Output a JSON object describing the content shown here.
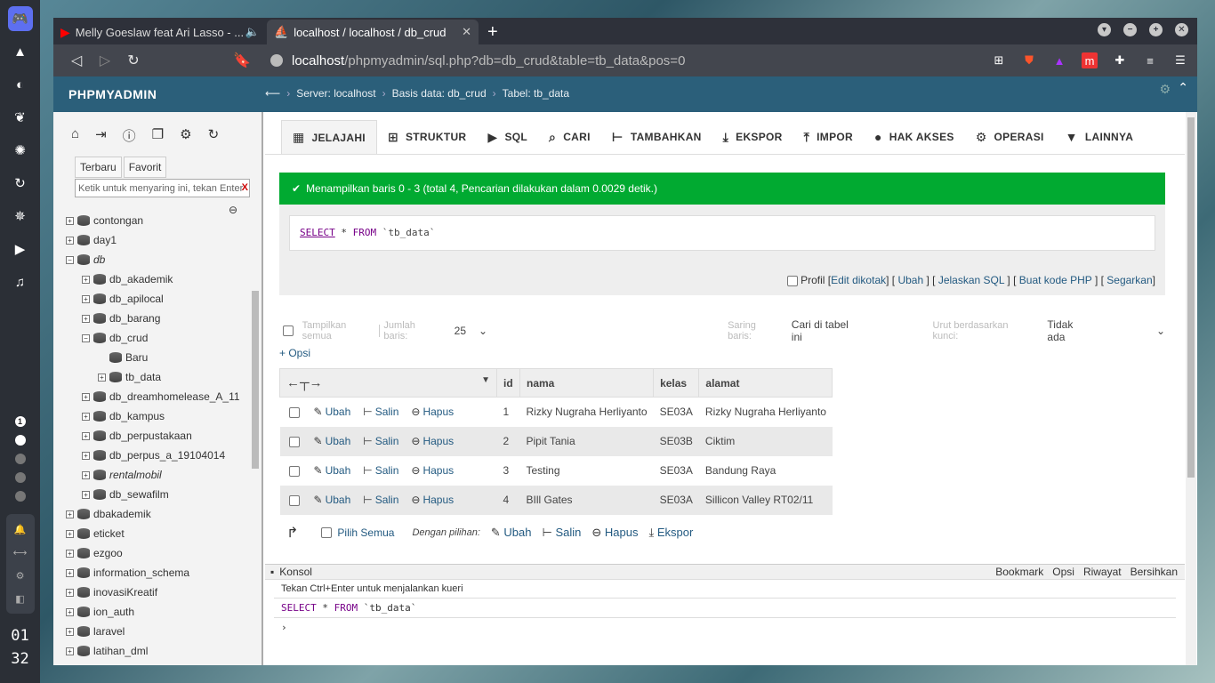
{
  "taskbar": {
    "clock_hour": "01",
    "clock_min": "32",
    "ws_num": "1"
  },
  "browser": {
    "tab1_title": "Melly Goeslaw feat Ari Lasso - ...",
    "tab2_title": "localhost / localhost / db_crud",
    "url_host": "localhost",
    "url_path": "/phpmyadmin/sql.php?db=db_crud&table=tb_data&pos=0"
  },
  "pma": {
    "logo": "PHPMYADMIN",
    "crumbs": [
      "Server: localhost",
      "Basis data: db_crud",
      "Tabel: tb_data"
    ],
    "side_tabs": [
      "Terbaru",
      "Favorit"
    ],
    "filter_placeholder": "Ketik untuk menyaring ini, tekan Enter",
    "tree": [
      {
        "label": "contongan",
        "level": 0,
        "exp": "+"
      },
      {
        "label": "day1",
        "level": 0,
        "exp": "+"
      },
      {
        "label": "db",
        "level": 0,
        "exp": "−",
        "italic": true
      },
      {
        "label": "db_akademik",
        "level": 1,
        "exp": "+"
      },
      {
        "label": "db_apilocal",
        "level": 1,
        "exp": "+"
      },
      {
        "label": "db_barang",
        "level": 1,
        "exp": "+"
      },
      {
        "label": "db_crud",
        "level": 1,
        "exp": "−"
      },
      {
        "label": "Baru",
        "level": 2,
        "exp": ""
      },
      {
        "label": "tb_data",
        "level": 2,
        "exp": "+"
      },
      {
        "label": "db_dreamhomelease_A_11",
        "level": 1,
        "exp": "+"
      },
      {
        "label": "db_kampus",
        "level": 1,
        "exp": "+"
      },
      {
        "label": "db_perpustakaan",
        "level": 1,
        "exp": "+"
      },
      {
        "label": "db_perpus_a_19104014",
        "level": 1,
        "exp": "+"
      },
      {
        "label": "rentalmobil",
        "level": 1,
        "exp": "+",
        "italic": true
      },
      {
        "label": "db_sewafilm",
        "level": 1,
        "exp": "+"
      },
      {
        "label": "dbakademik",
        "level": 0,
        "exp": "+"
      },
      {
        "label": "eticket",
        "level": 0,
        "exp": "+"
      },
      {
        "label": "ezgoo",
        "level": 0,
        "exp": "+"
      },
      {
        "label": "information_schema",
        "level": 0,
        "exp": "+"
      },
      {
        "label": "inovasiKreatif",
        "level": 0,
        "exp": "+"
      },
      {
        "label": "ion_auth",
        "level": 0,
        "exp": "+"
      },
      {
        "label": "laravel",
        "level": 0,
        "exp": "+"
      },
      {
        "label": "latihan_dml",
        "level": 0,
        "exp": "+"
      }
    ],
    "tabs": [
      "JELAJAHI",
      "STRUKTUR",
      "SQL",
      "CARI",
      "TAMBAHKAN",
      "EKSPOR",
      "IMPOR",
      "HAK AKSES",
      "OPERASI",
      "LAINNYA"
    ],
    "success_msg": "Menampilkan baris 0 - 3 (total 4, Pencarian dilakukan dalam 0.0029 detik.)",
    "sql": {
      "select": "SELECT",
      "star": " * ",
      "from": "FROM",
      "table": " `tb_data`"
    },
    "sql_links": {
      "profil": "Profil",
      "edit": "Edit dikotak",
      "ubah": "Ubah",
      "jelaskan": "Jelaskan SQL",
      "kode": "Buat kode PHP",
      "segarkan": "Segarkan"
    },
    "nav": {
      "tampilkan": "Tampilkan semua",
      "jumlah_label": "Jumlah baris:",
      "jumlah": "25",
      "saring_label": "Saring baris:",
      "saring_ph": "Cari di tabel ini",
      "urut_label": "Urut berdasarkan kunci:",
      "urut": "Tidak ada"
    },
    "opsi": "+ Opsi",
    "columns": [
      "id",
      "nama",
      "kelas",
      "alamat"
    ],
    "actions": {
      "ubah": "Ubah",
      "salin": "Salin",
      "hapus": "Hapus"
    },
    "rows": [
      [
        "1",
        "Rizky Nugraha Herliyanto",
        "SE03A",
        "Rizky Nugraha Herliyanto"
      ],
      [
        "2",
        "Pipit Tania",
        "SE03B",
        "Ciktim"
      ],
      [
        "3",
        "Testing",
        "SE03A",
        "Bandung Raya"
      ],
      [
        "4",
        "BIll Gates",
        "SE03A",
        "Sillicon Valley RT02/11"
      ]
    ],
    "bottom": {
      "pilih": "Pilih Semua",
      "dengan": "Dengan pilihan:",
      "ubah": "Ubah",
      "salin": "Salin",
      "hapus": "Hapus",
      "ekspor": "Ekspor"
    },
    "konsol": {
      "title": "Konsol",
      "bookmark": "Bookmark",
      "opsi": "Opsi",
      "riwayat": "Riwayat",
      "bersihkan": "Bersihkan",
      "hint": "Tekan Ctrl+Enter untuk menjalankan kueri",
      "q_select": "SELECT",
      "q_star": " * ",
      "q_from": "FROM",
      "q_table": " `tb_data`"
    }
  }
}
